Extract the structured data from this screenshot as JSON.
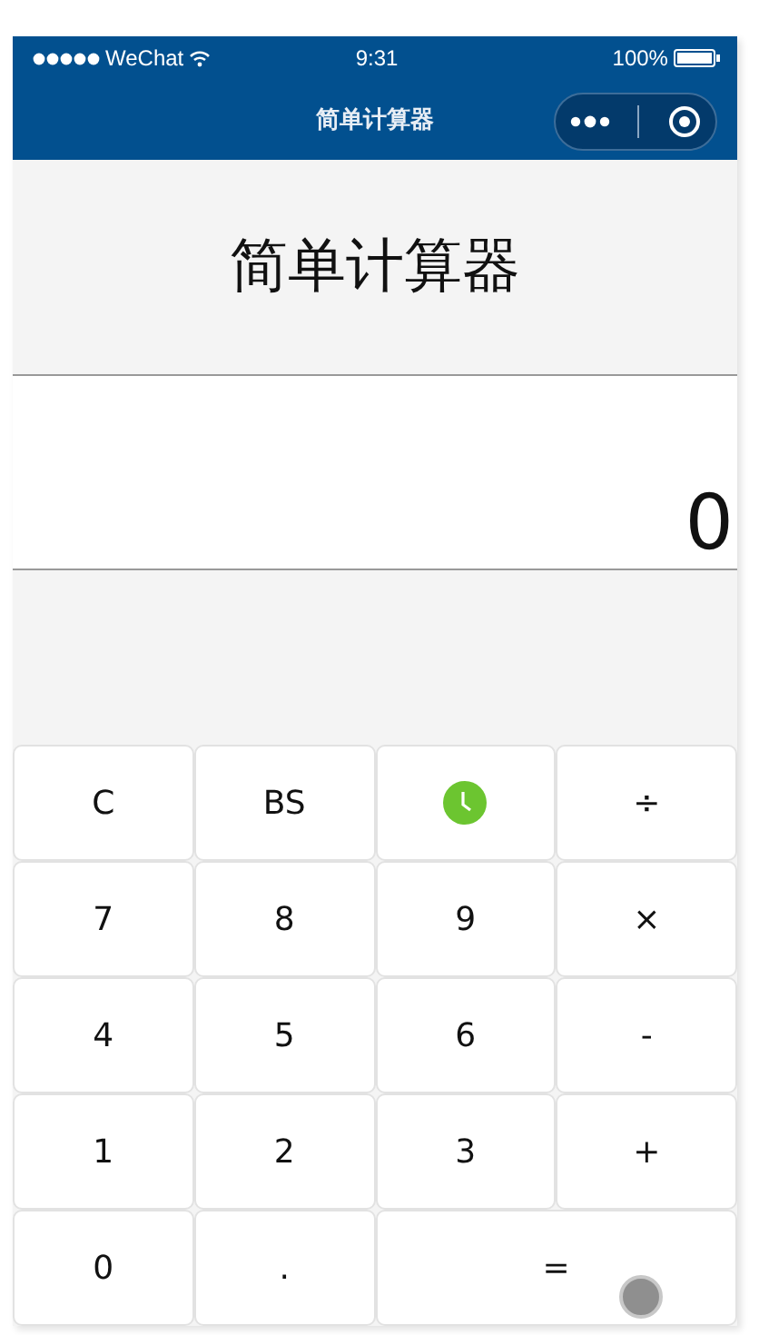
{
  "status_bar": {
    "carrier": "WeChat",
    "time": "9:31",
    "battery": "100%"
  },
  "nav": {
    "title": "简单计算器"
  },
  "heading": "简单计算器",
  "display": {
    "value": "0"
  },
  "keys": [
    {
      "label": "C",
      "kind": "text"
    },
    {
      "label": "BS",
      "kind": "text"
    },
    {
      "kind": "history"
    },
    {
      "label": "÷",
      "kind": "text"
    },
    {
      "label": "7",
      "kind": "text"
    },
    {
      "label": "8",
      "kind": "text"
    },
    {
      "label": "9",
      "kind": "text"
    },
    {
      "label": "×",
      "kind": "text"
    },
    {
      "label": "4",
      "kind": "text"
    },
    {
      "label": "5",
      "kind": "text"
    },
    {
      "label": "6",
      "kind": "text"
    },
    {
      "label": "-",
      "kind": "text"
    },
    {
      "label": "1",
      "kind": "text"
    },
    {
      "label": "2",
      "kind": "text"
    },
    {
      "label": "3",
      "kind": "text"
    },
    {
      "label": "+",
      "kind": "text"
    },
    {
      "label": "0",
      "kind": "text"
    },
    {
      "label": ".",
      "kind": "text"
    },
    {
      "label": "=",
      "kind": "wide"
    }
  ]
}
